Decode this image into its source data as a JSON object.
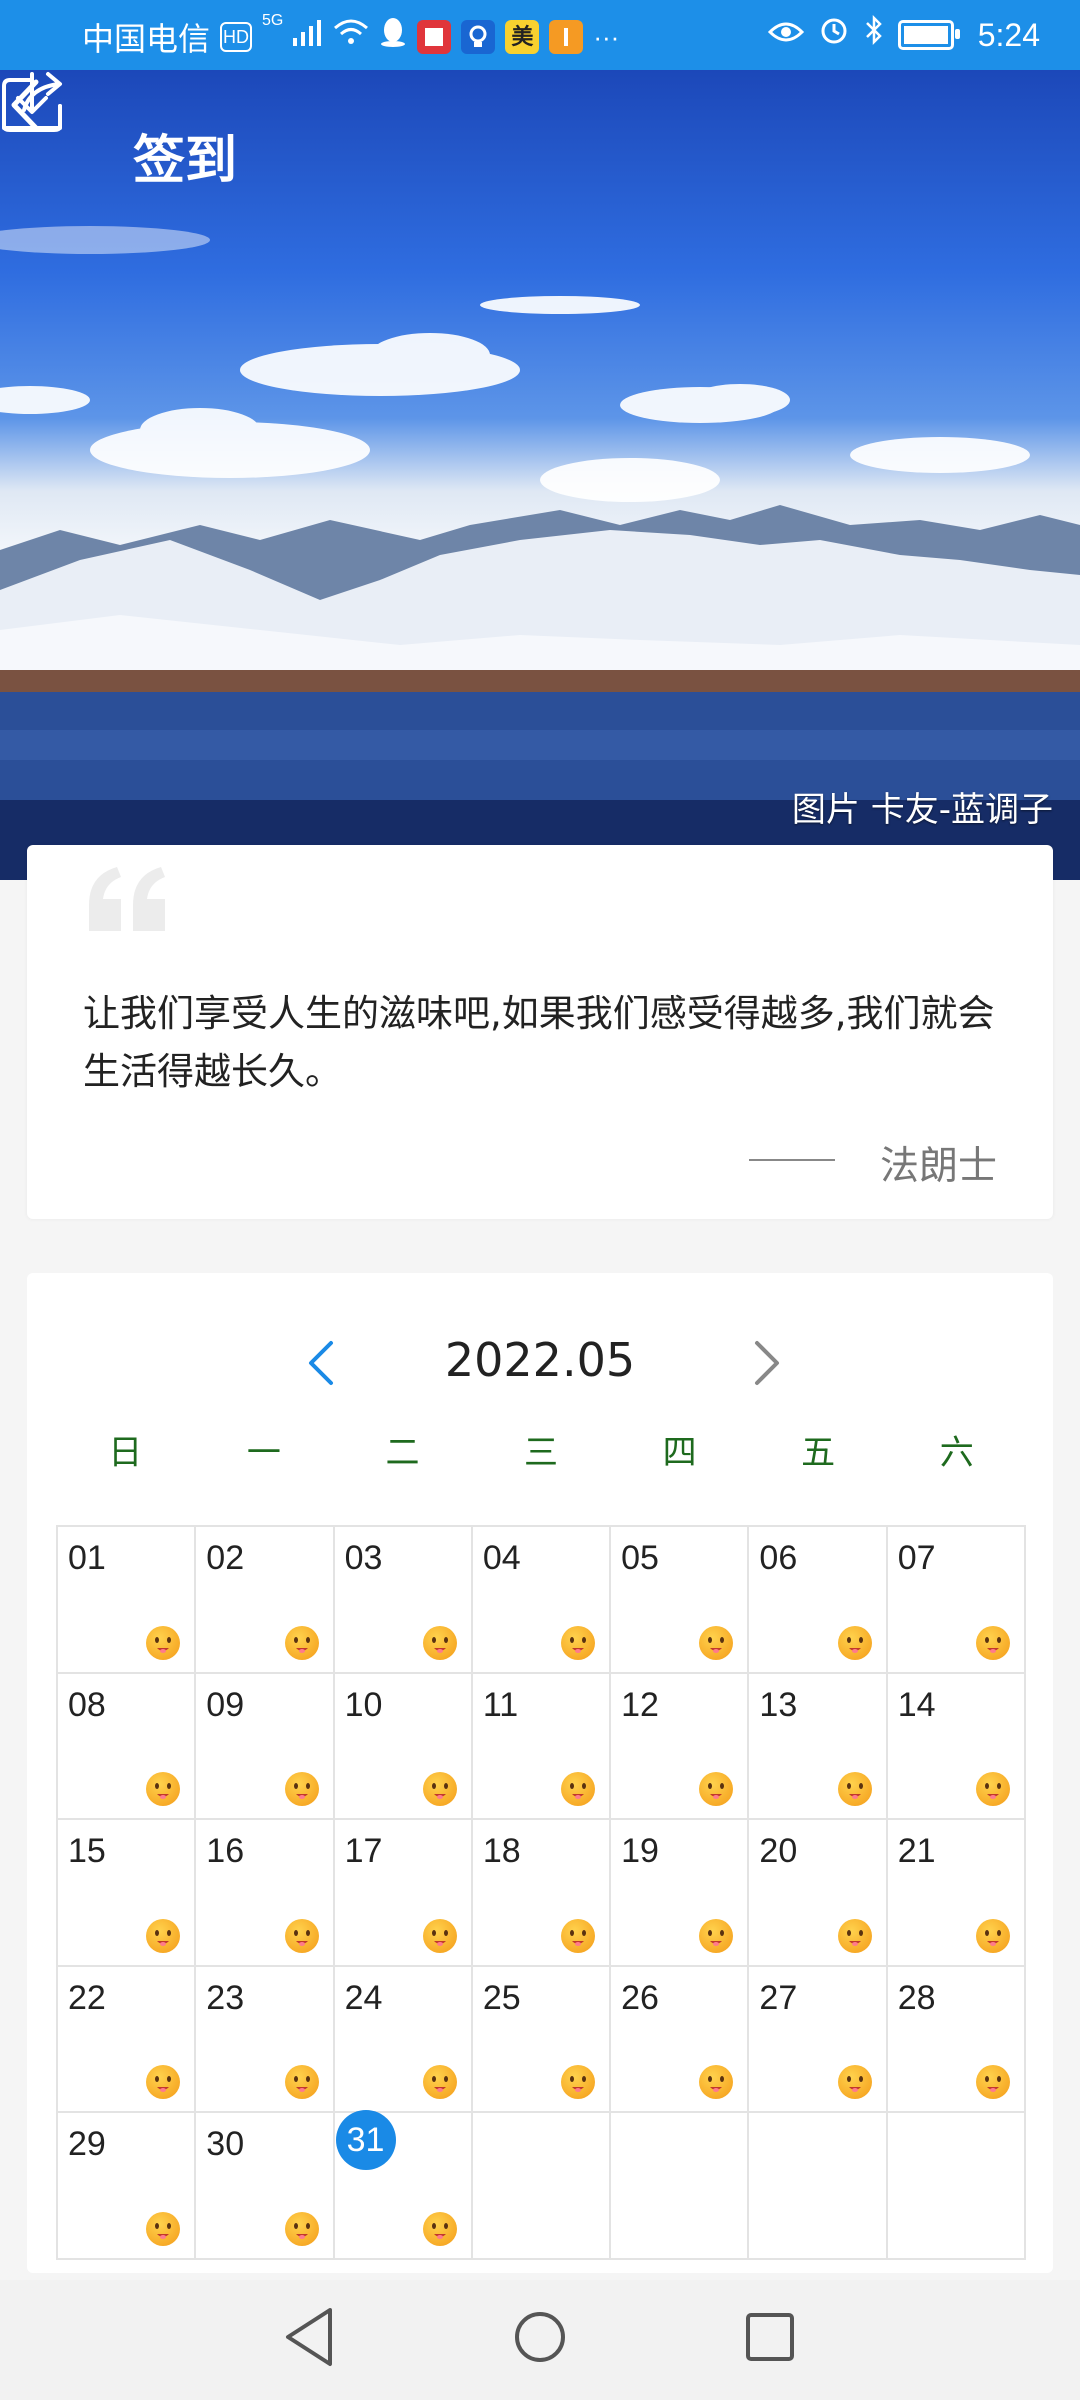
{
  "status_bar": {
    "carrier": "中国电信",
    "hd": "HD",
    "network": "5G",
    "time": "5:24",
    "app_badges": [
      "美"
    ]
  },
  "header": {
    "title": "签到",
    "photo_credit": "图片 卡友-蓝调子"
  },
  "quote": {
    "text": "让我们享受人生的滋味吧,如果我们感受得越多,我们就会生活得越长久。",
    "author": "法朗士"
  },
  "calendar": {
    "month": "2022.05",
    "weekdays": [
      "日",
      "一",
      "二",
      "三",
      "四",
      "五",
      "六"
    ],
    "days": [
      "01",
      "02",
      "03",
      "04",
      "05",
      "06",
      "07",
      "08",
      "09",
      "10",
      "11",
      "12",
      "13",
      "14",
      "15",
      "16",
      "17",
      "18",
      "19",
      "20",
      "21",
      "22",
      "23",
      "24",
      "25",
      "26",
      "27",
      "28",
      "29",
      "30",
      "31"
    ],
    "today": "31",
    "colors": {
      "today_bg": "#1a8ae6",
      "weekday_text": "#1e6a1e",
      "statusbar_bg": "#1d8fe8"
    }
  }
}
